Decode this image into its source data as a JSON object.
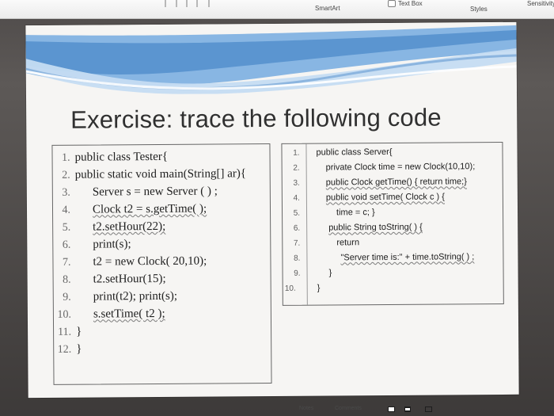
{
  "app": {
    "ribbon": {
      "smartart_label": "SmartArt",
      "textbox_label": "Text Box",
      "styles_label": "Styles",
      "sensitivity_label": "Sensitivity"
    },
    "statusbar": {
      "notes_label": "Notes",
      "comments_label": "Comments"
    }
  },
  "slide": {
    "title": "Exercise: trace the following code",
    "tester_code": [
      {
        "num": "1.",
        "text": "public class Tester{"
      },
      {
        "num": "2.",
        "text": "public static void main(String[] ar){"
      },
      {
        "num": "3.",
        "text": "Server s = new Server ( ) ;"
      },
      {
        "num": "4.",
        "text": "Clock t2 = s.getTime( );"
      },
      {
        "num": "5.",
        "text": "t2.setHour(22);"
      },
      {
        "num": "6.",
        "text": "print(s);"
      },
      {
        "num": "7.",
        "text": "t2 = new Clock( 20,10);"
      },
      {
        "num": "8.",
        "text": "t2.setHour(15);"
      },
      {
        "num": "9.",
        "text": "print(t2); print(s);"
      },
      {
        "num": "10.",
        "text": "s.setTime( t2 );"
      },
      {
        "num": "11.",
        "text": "}"
      },
      {
        "num": "12.",
        "text": "}"
      }
    ],
    "server_code": [
      {
        "num": "1.",
        "text": "public class Server{"
      },
      {
        "num": "2.",
        "text": "private Clock time = new Clock(10,10);"
      },
      {
        "num": "3.",
        "text": "public Clock getTime() { return time;}"
      },
      {
        "num": "4.",
        "text": "public void setTime( Clock c ) {"
      },
      {
        "num": "5.",
        "text": "time = c; }"
      },
      {
        "num": "6.",
        "text": "public String toString( ) {"
      },
      {
        "num": "7.",
        "text": "return"
      },
      {
        "num": "8.",
        "text": "\"Server time is:\" + time.toString( ) ;"
      },
      {
        "num": "9.",
        "text": "}"
      },
      {
        "num": "10.",
        "text": "}"
      }
    ]
  },
  "colors": {
    "slide_bg": "#f6f5f3",
    "banner_blue": "#78a8d8",
    "banner_light": "#c9def2",
    "text": "#303030"
  },
  "icons": {
    "text_box_icon": "text-box-icon",
    "notes_icon": "notes-icon",
    "comments_icon": "comments-icon",
    "view_icons": [
      "normal-view-icon",
      "slide-sorter-icon",
      "reading-view-icon"
    ]
  }
}
